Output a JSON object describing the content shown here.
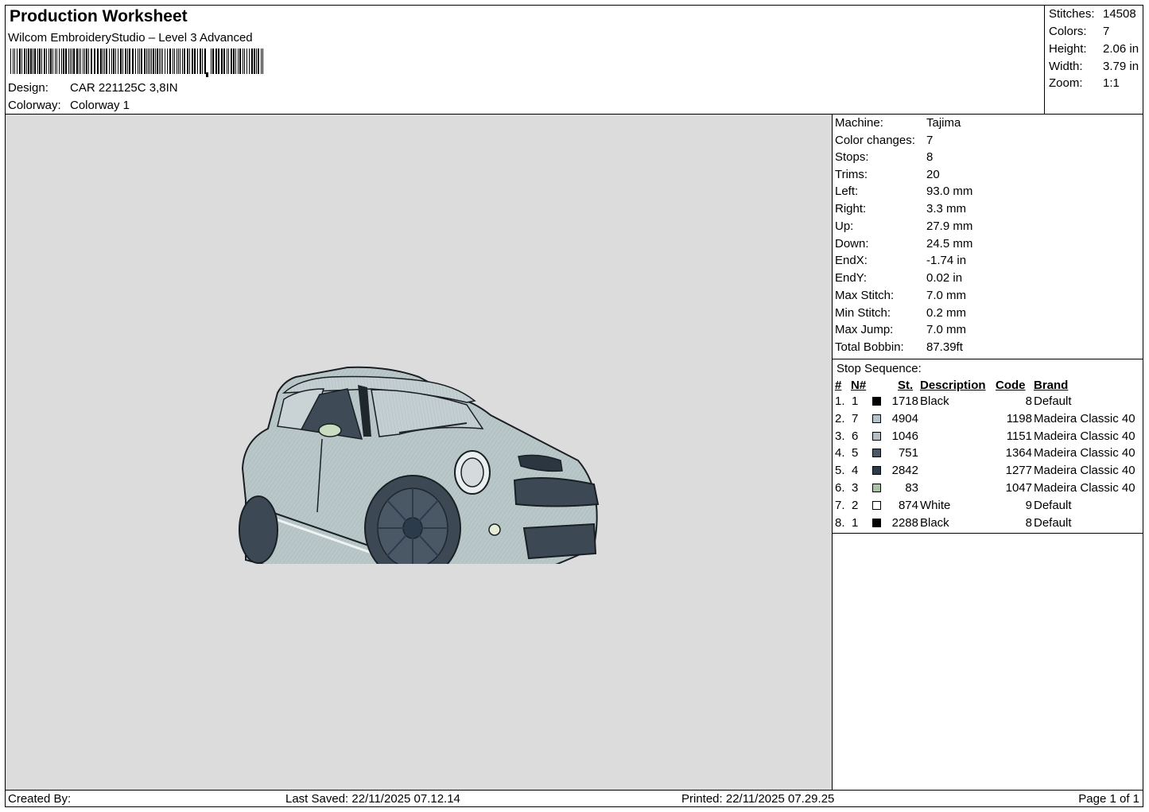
{
  "header": {
    "title": "Production Worksheet",
    "subtitle": "Wilcom EmbroideryStudio – Level 3 Advanced",
    "design_label": "Design:",
    "design_value": "CAR 221125C 3,8IN",
    "colorway_label": "Colorway:",
    "colorway_value": "Colorway 1"
  },
  "summary": {
    "stitches_label": "Stitches:",
    "stitches_value": "14508",
    "colors_label": "Colors:",
    "colors_value": "7",
    "height_label": "Height:",
    "height_value": "2.06 in",
    "width_label": "Width:",
    "width_value": "3.79 in",
    "zoom_label": "Zoom:",
    "zoom_value": "1:1"
  },
  "info": {
    "machine_label": "Machine:",
    "machine_value": "Tajima",
    "colorchanges_label": "Color changes:",
    "colorchanges_value": "7",
    "stops_label": "Stops:",
    "stops_value": "8",
    "trims_label": "Trims:",
    "trims_value": "20",
    "left_label": "Left:",
    "left_value": "93.0 mm",
    "right_label": "Right:",
    "right_value": "3.3 mm",
    "up_label": "Up:",
    "up_value": "27.9 mm",
    "down_label": "Down:",
    "down_value": "24.5 mm",
    "endx_label": "EndX:",
    "endx_value": "-1.74 in",
    "endy_label": "EndY:",
    "endy_value": "0.02 in",
    "maxstitch_label": "Max Stitch:",
    "maxstitch_value": "7.0 mm",
    "minstitch_label": "Min Stitch:",
    "minstitch_value": "0.2 mm",
    "maxjump_label": "Max Jump:",
    "maxjump_value": "7.0 mm",
    "bobbin_label": "Total Bobbin:",
    "bobbin_value": "87.39ft"
  },
  "stop_sequence": {
    "title": "Stop Sequence:",
    "headers": {
      "idx": "#",
      "num": "N#",
      "st": "St.",
      "desc": "Description",
      "code": "Code",
      "brand": "Brand"
    },
    "rows": [
      {
        "idx": "1.",
        "num": "1",
        "color": "#000000",
        "st": "1718",
        "desc": "Black",
        "code": "8",
        "brand": "Default"
      },
      {
        "idx": "2.",
        "num": "7",
        "color": "#b4c4cc",
        "st": "4904",
        "desc": "",
        "code": "1198",
        "brand": "Madeira Classic 40"
      },
      {
        "idx": "3.",
        "num": "6",
        "color": "#b8bfc4",
        "st": "1046",
        "desc": "",
        "code": "1151",
        "brand": "Madeira Classic 40"
      },
      {
        "idx": "4.",
        "num": "5",
        "color": "#4a5866",
        "st": "751",
        "desc": "",
        "code": "1364",
        "brand": "Madeira Classic 40"
      },
      {
        "idx": "5.",
        "num": "4",
        "color": "#2c3b4a",
        "st": "2842",
        "desc": "",
        "code": "1277",
        "brand": "Madeira Classic 40"
      },
      {
        "idx": "6.",
        "num": "3",
        "color": "#a8c4a4",
        "st": "83",
        "desc": "",
        "code": "1047",
        "brand": "Madeira Classic 40"
      },
      {
        "idx": "7.",
        "num": "2",
        "color": "#ffffff",
        "st": "874",
        "desc": "White",
        "code": "9",
        "brand": "Default"
      },
      {
        "idx": "8.",
        "num": "1",
        "color": "#000000",
        "st": "2288",
        "desc": "Black",
        "code": "8",
        "brand": "Default"
      }
    ]
  },
  "footer": {
    "created_by": "Created By:",
    "last_saved": "Last Saved: 22/11/2025 07.12.14",
    "printed": "Printed: 22/11/2025 07.29.25",
    "page": "Page 1 of 1"
  }
}
